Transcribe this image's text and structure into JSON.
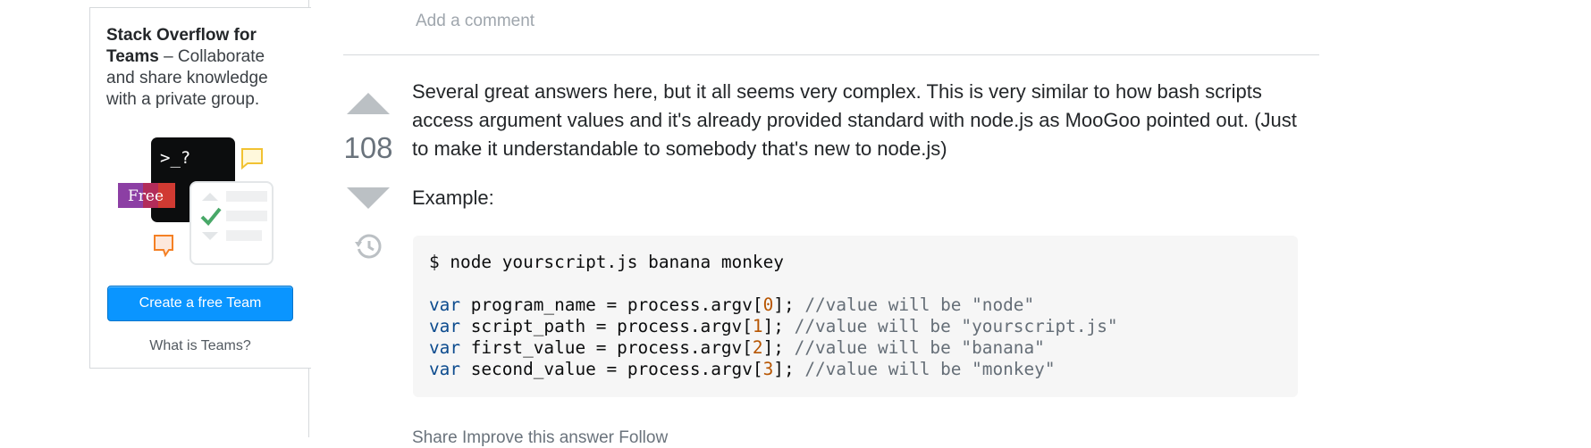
{
  "sidebar": {
    "teams_card": {
      "title_bold": "Stack Overflow for Teams",
      "title_rest": " – Collaborate and share knowledge with a private group.",
      "illustration": {
        "terminal_prompt": ">_?",
        "badge_label": "Free"
      },
      "create_button_label": "Create a free Team",
      "what_is_link": "What is Teams?"
    }
  },
  "main": {
    "add_comment_label": "Add a comment",
    "answer": {
      "vote_count": "108",
      "paragraph": "Several great answers here, but it all seems very complex. This is very similar to how bash scripts access argument values and it's already provided standard with node.js as MooGoo pointed out. (Just to make it understandable to somebody that's new to node.js)",
      "example_label": "Example:",
      "code": {
        "command_line": "$ node yourscript.js banana monkey",
        "lines": [
          {
            "keyword": "var",
            "text": " program_name = process.argv[",
            "index": "0",
            "after": "]; ",
            "comment": "//value will be \"node\""
          },
          {
            "keyword": "var",
            "text": " script_path = process.argv[",
            "index": "1",
            "after": "]; ",
            "comment": "//value will be \"yourscript.js\""
          },
          {
            "keyword": "var",
            "text": " first_value = process.argv[",
            "index": "2",
            "after": "]; ",
            "comment": "//value will be \"banana\""
          },
          {
            "keyword": "var",
            "text": " second_value = process.argv[",
            "index": "3",
            "after": "]; ",
            "comment": "//value will be \"monkey\""
          }
        ]
      },
      "footer_cut": "Share  Improve this answer  Follow"
    }
  },
  "colors": {
    "accent_button": "#0a95ff",
    "vote_arrow": "#bbc0c4",
    "code_bg": "#f6f6f6"
  },
  "icons": {
    "upvote": "triangle-up-icon",
    "downvote": "triangle-down-icon",
    "history": "history-icon",
    "chat_bubble_yellow": "chat-bubble-icon",
    "chat_bubble_orange": "chat-bubble-icon",
    "checkmark": "check-icon"
  }
}
